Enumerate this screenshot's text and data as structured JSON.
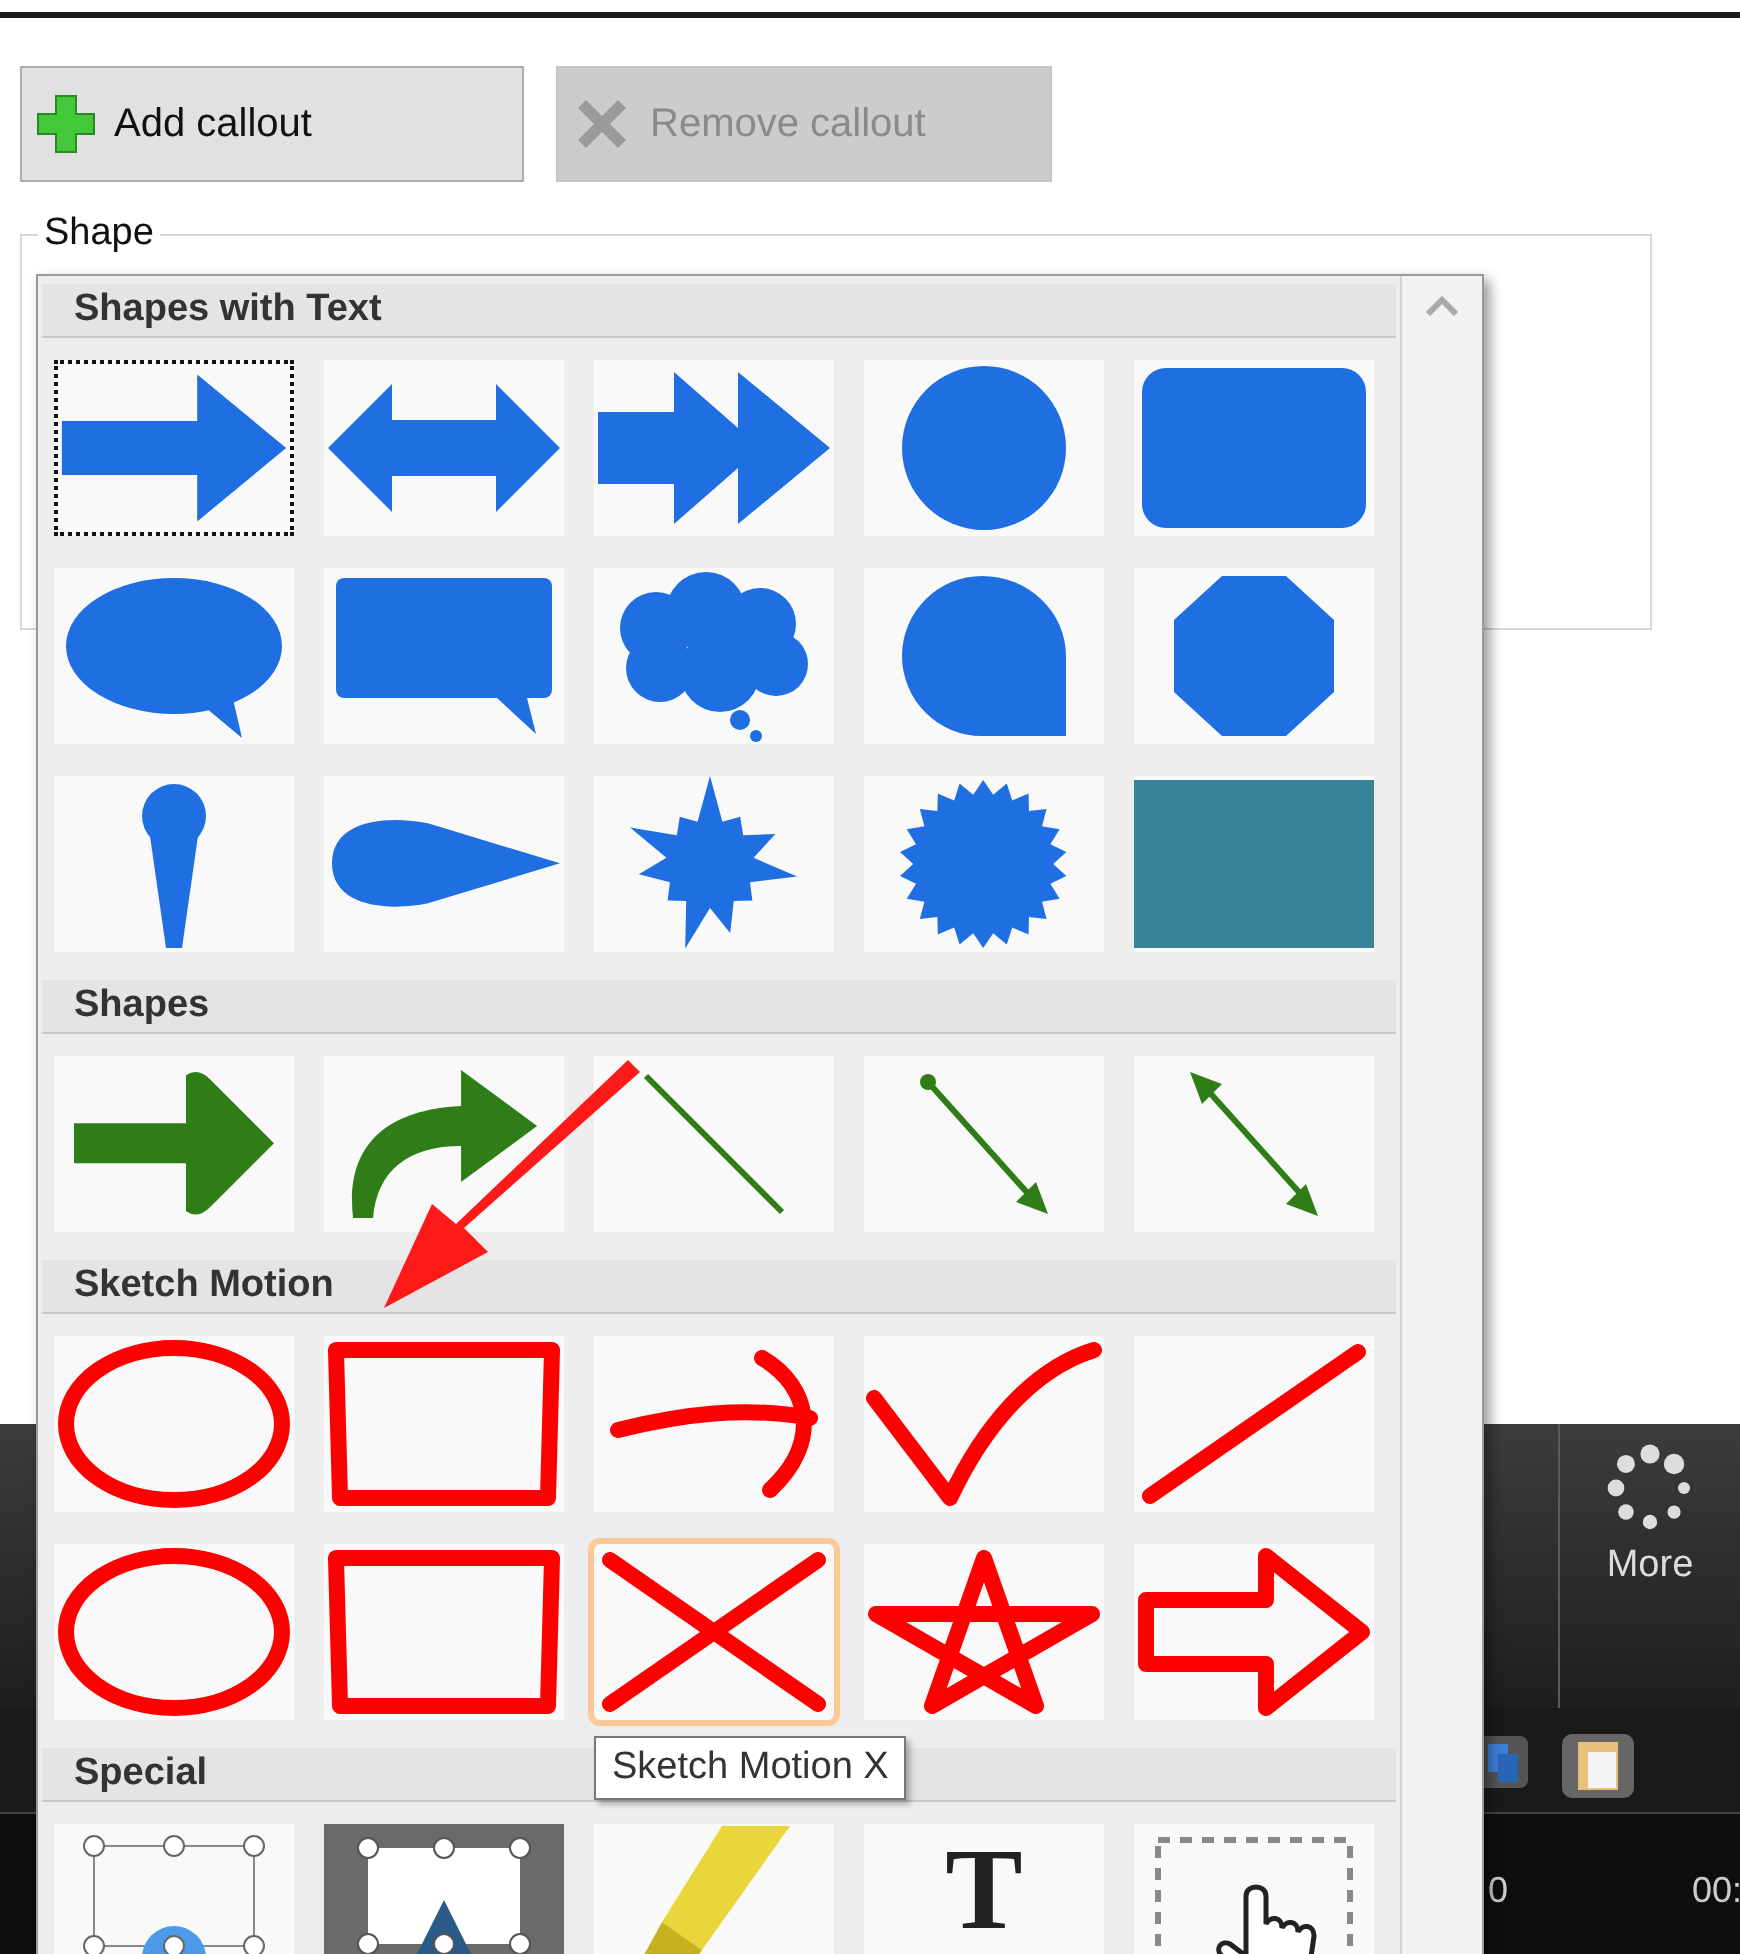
{
  "buttons": [
    {
      "label": "Add callout",
      "kind": "add",
      "disabled": false
    },
    {
      "label": "Remove callout",
      "kind": "remove",
      "disabled": true
    }
  ],
  "shape_group": {
    "label": "Shape"
  },
  "shape_gallery": {
    "sections": [
      {
        "title": "Shapes with Text",
        "items": [
          {
            "kind": "arrow",
            "selected": true,
            "hovered": false
          },
          {
            "kind": "double-arrow",
            "selected": false,
            "hovered": false
          },
          {
            "kind": "chevron-arrow",
            "selected": false,
            "hovered": false
          },
          {
            "kind": "circle",
            "selected": false,
            "hovered": false
          },
          {
            "kind": "rounded-rect",
            "selected": false,
            "hovered": false
          },
          {
            "kind": "speech-oval",
            "selected": false,
            "hovered": false
          },
          {
            "kind": "speech-rect",
            "selected": false,
            "hovered": false
          },
          {
            "kind": "thought-cloud",
            "selected": false,
            "hovered": false
          },
          {
            "kind": "round-callout",
            "selected": false,
            "hovered": false
          },
          {
            "kind": "octagon",
            "selected": false,
            "hovered": false
          },
          {
            "kind": "pin",
            "selected": false,
            "hovered": false
          },
          {
            "kind": "teardrop",
            "selected": false,
            "hovered": false
          },
          {
            "kind": "burst",
            "selected": false,
            "hovered": false
          },
          {
            "kind": "starburst",
            "selected": false,
            "hovered": false
          },
          {
            "kind": "teal-rect",
            "selected": false,
            "hovered": false
          }
        ]
      },
      {
        "title": "Shapes",
        "items": [
          {
            "kind": "green-arrow",
            "selected": false,
            "hovered": false
          },
          {
            "kind": "curved-arrow",
            "selected": false,
            "hovered": false
          },
          {
            "kind": "line",
            "selected": false,
            "hovered": false
          },
          {
            "kind": "line-arrow",
            "selected": false,
            "hovered": false
          },
          {
            "kind": "double-line-arrow",
            "selected": false,
            "hovered": false
          }
        ]
      },
      {
        "title": "Sketch Motion",
        "items": [
          {
            "kind": "sketch-oval",
            "selected": false,
            "hovered": false
          },
          {
            "kind": "sketch-rect",
            "selected": false,
            "hovered": false
          },
          {
            "kind": "sketch-arrow",
            "selected": false,
            "hovered": false
          },
          {
            "kind": "sketch-check",
            "selected": false,
            "hovered": false
          },
          {
            "kind": "sketch-line",
            "selected": false,
            "hovered": false
          },
          {
            "kind": "sketch-oval",
            "selected": false,
            "hovered": false
          },
          {
            "kind": "sketch-rect",
            "selected": false,
            "hovered": false
          },
          {
            "kind": "sketch-x",
            "selected": false,
            "hovered": true
          },
          {
            "kind": "sketch-star",
            "selected": false,
            "hovered": false
          },
          {
            "kind": "sketch-block-arrow",
            "selected": false,
            "hovered": false
          }
        ]
      },
      {
        "title": "Special",
        "items": [
          {
            "kind": "blur",
            "selected": false,
            "hovered": false
          },
          {
            "kind": "spotlight",
            "selected": false,
            "hovered": false
          },
          {
            "kind": "highlight",
            "selected": false,
            "hovered": false
          },
          {
            "kind": "text",
            "glyph": "T",
            "selected": false,
            "hovered": false
          },
          {
            "kind": "click",
            "selected": false,
            "hovered": false
          }
        ]
      }
    ]
  },
  "tooltip": {
    "text": "Sketch Motion X"
  },
  "toolbar": {
    "more_label": "More"
  },
  "timeline": {
    "labels": [
      "0",
      "00:"
    ]
  }
}
